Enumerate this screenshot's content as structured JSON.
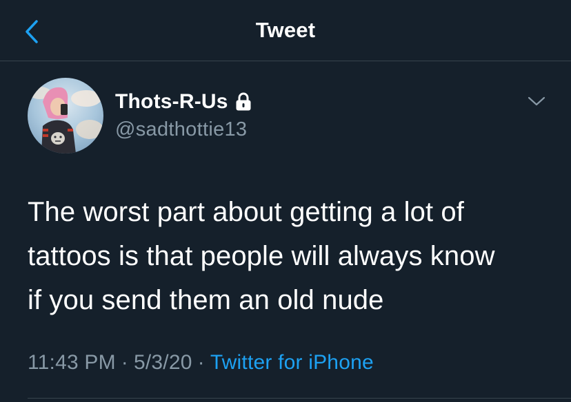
{
  "header": {
    "title": "Tweet",
    "back_icon": "chevron-left-icon"
  },
  "tweet": {
    "author": {
      "display_name": "Thots-R-Us",
      "handle": "@sadthottie13",
      "protected_icon": "lock-icon",
      "avatar_icon": "profile-photo"
    },
    "menu_icon": "chevron-down-icon",
    "text": "The worst part about getting a lot of\ntattoos is that people will always know\nif you send them an old nude",
    "time": "11:43 PM",
    "date": "5/3/20",
    "separator": "·",
    "source": "Twitter for iPhone"
  },
  "colors": {
    "background": "#15202b",
    "text_primary": "#ffffff",
    "text_secondary": "#8899a6",
    "accent": "#1da1f2",
    "divider": "#38444d"
  }
}
